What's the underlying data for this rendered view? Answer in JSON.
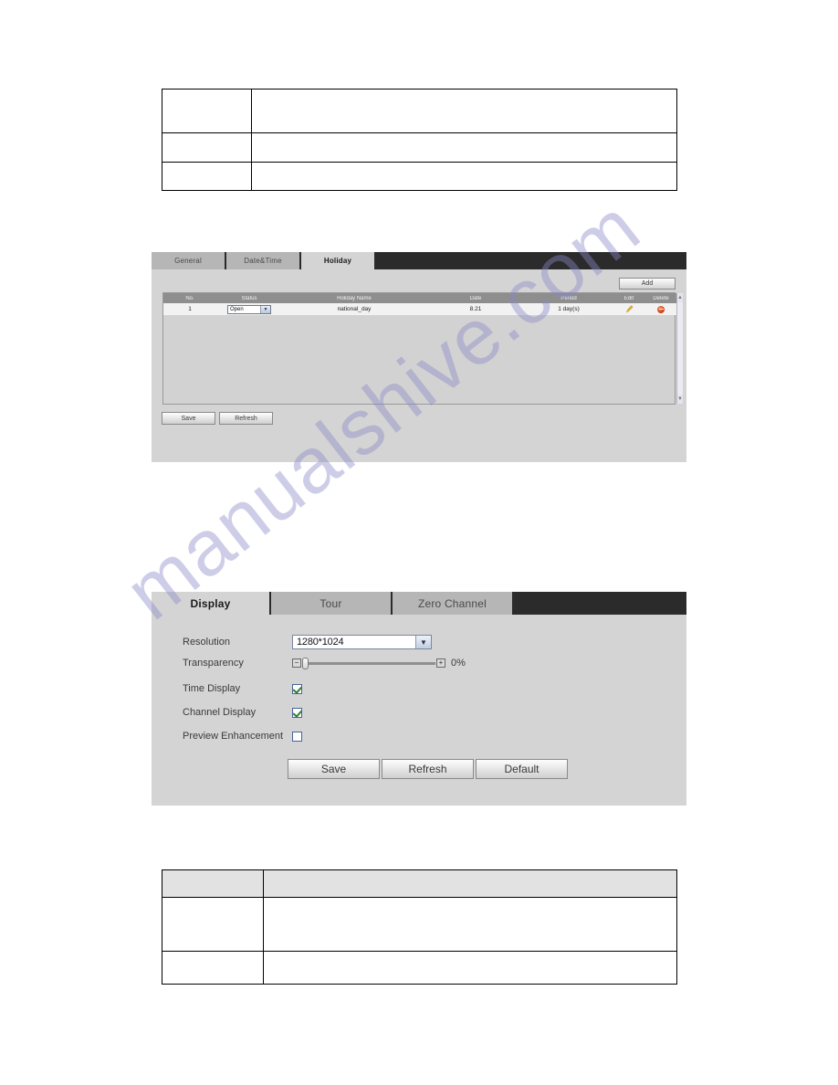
{
  "watermark": {
    "text": "manualshive.com"
  },
  "doc_tables": {
    "top": {
      "rows": [
        {
          "cells": [
            "",
            ""
          ],
          "header": false
        },
        {
          "cells": [
            "",
            ""
          ],
          "header": false
        },
        {
          "cells": [
            "",
            ""
          ],
          "header": false
        }
      ]
    },
    "bottom": {
      "rows": [
        {
          "cells": [
            "",
            ""
          ],
          "header": true
        },
        {
          "cells": [
            "",
            ""
          ],
          "header": false
        },
        {
          "cells": [
            "",
            ""
          ],
          "header": false
        }
      ]
    }
  },
  "holiday_panel": {
    "tabs": [
      {
        "label": "General",
        "active": false
      },
      {
        "label": "Date&Time",
        "active": false
      },
      {
        "label": "Holiday",
        "active": true
      }
    ],
    "add_label": "Add",
    "grid": {
      "columns": [
        "No.",
        "Status",
        "Holiday Name",
        "Date",
        "Period",
        "Edit",
        "Delete"
      ],
      "rows": [
        {
          "no": "1",
          "status": "Open",
          "holiday_name": "national_day",
          "date": "8.21",
          "period": "1 day(s)",
          "edit_icon": "pencil-icon",
          "delete_icon": "delete-circle-icon"
        }
      ]
    },
    "scrollbar": {
      "up": "▲",
      "down": "▼"
    },
    "save_label": "Save",
    "refresh_label": "Refresh"
  },
  "display_panel": {
    "tabs": [
      {
        "label": "Display",
        "active": true
      },
      {
        "label": "Tour",
        "active": false
      },
      {
        "label": "Zero Channel",
        "active": false
      }
    ],
    "fields": {
      "resolution_label": "Resolution",
      "resolution_value": "1280*1024",
      "transparency_label": "Transparency",
      "transparency_value": "0%",
      "transparency_percent": 0,
      "minus_symbol": "−",
      "plus_symbol": "+",
      "time_display_label": "Time Display",
      "time_display_checked": true,
      "channel_display_label": "Channel Display",
      "channel_display_checked": true,
      "preview_enhancement_label": "Preview Enhancement",
      "preview_enhancement_checked": false
    },
    "save_label": "Save",
    "refresh_label": "Refresh",
    "default_label": "Default"
  },
  "colors": {
    "panel_bg": "#d4d4d4",
    "tabbar_bg": "#2b2b2b",
    "tab_inactive": "#b6b6b6",
    "grid_header": "#8e8e8e",
    "delete_icon": "#cf3a14",
    "check_green": "#2e7d32",
    "watermark": "#8a87c8"
  }
}
